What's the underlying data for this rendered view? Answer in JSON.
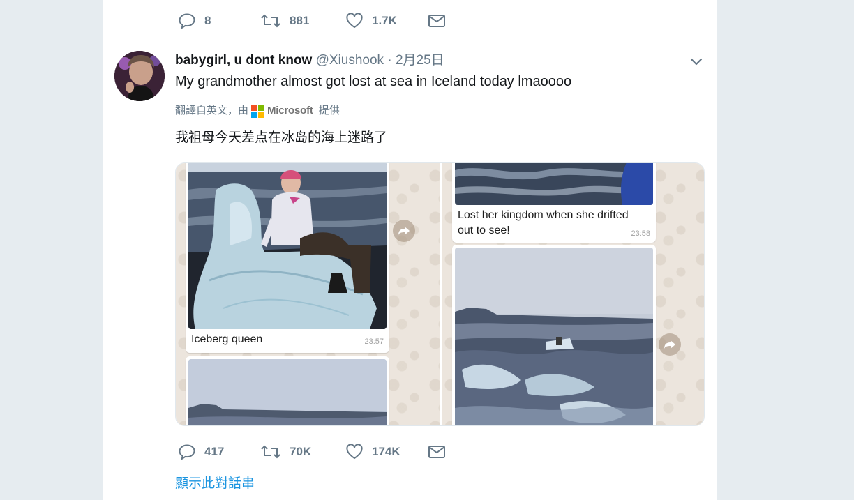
{
  "prev_tweet": {
    "actions": {
      "reply_count": "8",
      "retweet_count": "881",
      "like_count": "1.7K"
    }
  },
  "tweet": {
    "display_name": "babygirl, u dont know",
    "handle": "@Xiushook",
    "separator": "·",
    "date": "2月25日",
    "text": "My grandmother almost got lost at sea in Iceland today lmaoooo",
    "translation_prefix": "翻譯自英文，由",
    "translation_provider": "Microsoft",
    "translation_suffix": "提供",
    "translated_text": "我祖母今天差点在冰岛的海上迷路了",
    "media": {
      "left_caption": "Iceberg queen",
      "left_time": "23:57",
      "right_caption_line1": "Lost her kingdom when she drifted",
      "right_caption_line2": "out to see!",
      "right_time": "23:58"
    },
    "actions": {
      "reply_count": "417",
      "retweet_count": "70K",
      "like_count": "174K"
    },
    "show_thread": "顯示此對話串"
  },
  "colors": {
    "page_bg": "#e6ecf0",
    "link": "#1b95e0",
    "secondary_text": "#657786",
    "chat_bg": "#ece5dd"
  },
  "icons": [
    "reply-icon",
    "retweet-icon",
    "like-icon",
    "message-icon",
    "caret-down-icon",
    "forward-icon",
    "microsoft-logo"
  ]
}
